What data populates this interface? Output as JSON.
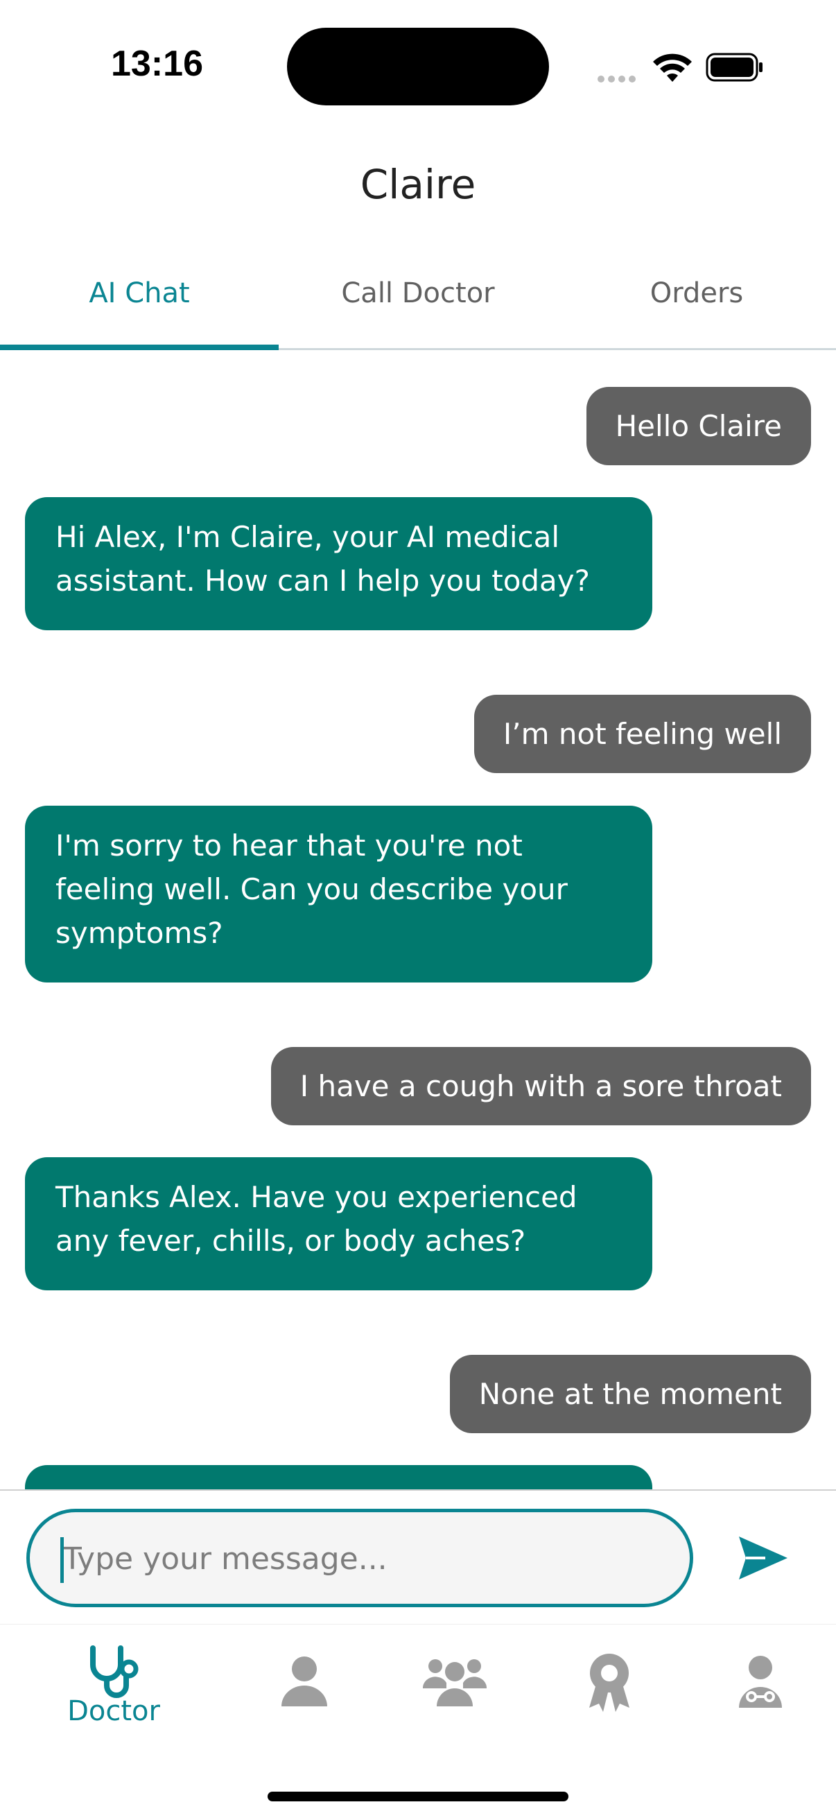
{
  "status_bar": {
    "time": "13:16"
  },
  "header": {
    "title": "Claire"
  },
  "tabs": [
    {
      "label": "AI Chat",
      "active": true
    },
    {
      "label": "Call Doctor",
      "active": false
    },
    {
      "label": "Orders",
      "active": false
    }
  ],
  "messages": [
    {
      "sender": "user",
      "text": "Hello Claire"
    },
    {
      "sender": "assistant",
      "text": "Hi Alex, I'm Claire, your AI medical assistant. How can I help you today?"
    },
    {
      "sender": "user",
      "text": "I’m not feeling well"
    },
    {
      "sender": "assistant",
      "text": "I'm sorry to hear that you're not feeling well. Can you describe your symptoms?"
    },
    {
      "sender": "user",
      "text": "I have a cough with a sore throat"
    },
    {
      "sender": "assistant",
      "text": "Thanks Alex. Have you experienced any fever, chills, or body aches?"
    },
    {
      "sender": "user",
      "text": "None at the moment"
    },
    {
      "sender": "assistant",
      "text": ""
    }
  ],
  "composer": {
    "placeholder": "Type your message...",
    "value": "",
    "send_icon": "send-icon"
  },
  "bottom_nav": [
    {
      "icon": "stethoscope-icon",
      "label": "Doctor",
      "active": true
    },
    {
      "icon": "person-icon",
      "label": "",
      "active": false
    },
    {
      "icon": "group-icon",
      "label": "",
      "active": false
    },
    {
      "icon": "award-icon",
      "label": "",
      "active": false
    },
    {
      "icon": "doctor-icon",
      "label": "",
      "active": false
    }
  ],
  "colors": {
    "accent": "#0a8592",
    "assistant_bubble": "#01796e",
    "user_bubble": "#616161",
    "inactive_icon": "#9e9e9e"
  }
}
